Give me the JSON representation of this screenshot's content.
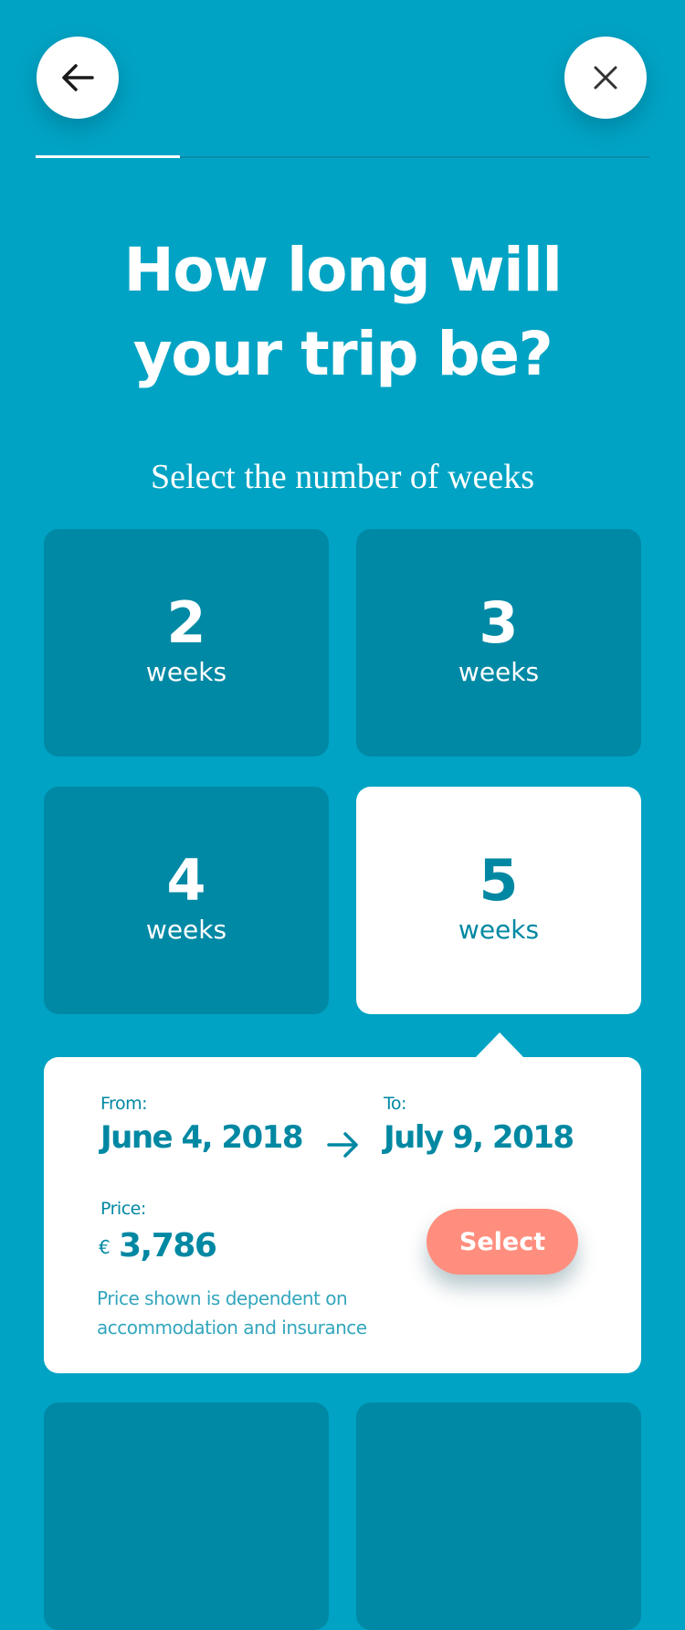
{
  "header": {
    "back_icon": "arrow-left-icon",
    "close_icon": "close-icon",
    "progress_fraction": 0.235
  },
  "question": {
    "title_line1": "How long will",
    "title_line2": "your trip be?",
    "subtitle": "Select the number of weeks"
  },
  "options": [
    {
      "number": "2",
      "unit": "weeks",
      "selected": false
    },
    {
      "number": "3",
      "unit": "weeks",
      "selected": false
    },
    {
      "number": "4",
      "unit": "weeks",
      "selected": false
    },
    {
      "number": "5",
      "unit": "weeks",
      "selected": true
    }
  ],
  "details": {
    "from_label": "From:",
    "from_date": "June 4, 2018",
    "to_label": "To:",
    "to_date": "July 9, 2018",
    "arrow_icon": "arrow-right-icon",
    "price_label": "Price:",
    "currency": "€",
    "price": "3,786",
    "note": "Price shown is dependent on accommodation and insurance",
    "select_label": "Select"
  },
  "colors": {
    "background": "#00A3C4",
    "card": "#0089A5",
    "selected_card": "#FFFFFF",
    "text_accent": "#0088A3",
    "select_button": "#FF8E7E"
  }
}
